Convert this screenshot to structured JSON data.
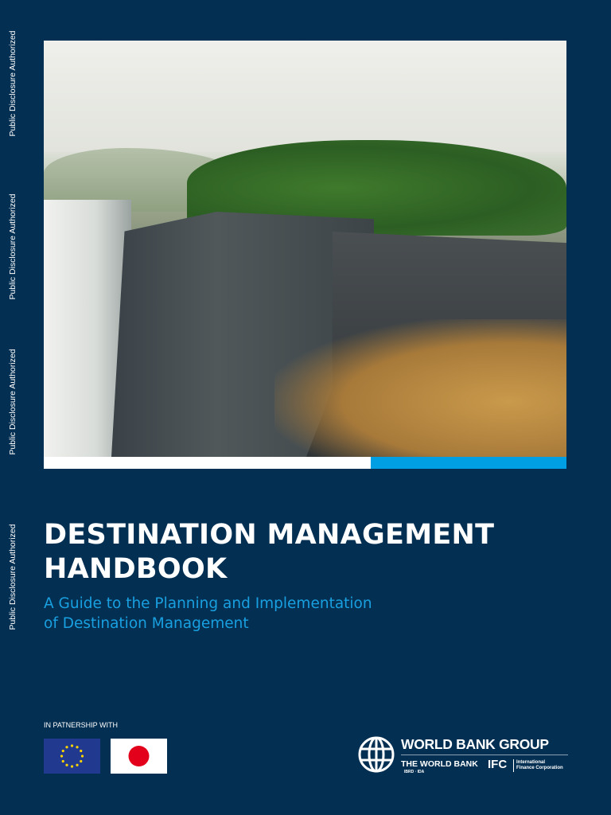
{
  "side_label": "Public Disclosure Authorized",
  "title_line1": "DESTINATION MANAGEMENT",
  "title_line2": "HANDBOOK",
  "subtitle_line1": "A Guide to the Planning and Implementation",
  "subtitle_line2": "of Destination Management",
  "partnership_label": "IN PATNERSHIP WITH",
  "logo": {
    "group": "WORLD BANK GROUP",
    "world_bank": "THE WORLD BANK",
    "ibrd": "IBRD · IDA",
    "ifc": "IFC",
    "ifc_line1": "International",
    "ifc_line2": "Finance Corporation"
  },
  "colors": {
    "background": "#032f52",
    "accent": "#009fe3",
    "eu_blue": "#213a8f",
    "japan_red": "#e3001b"
  }
}
